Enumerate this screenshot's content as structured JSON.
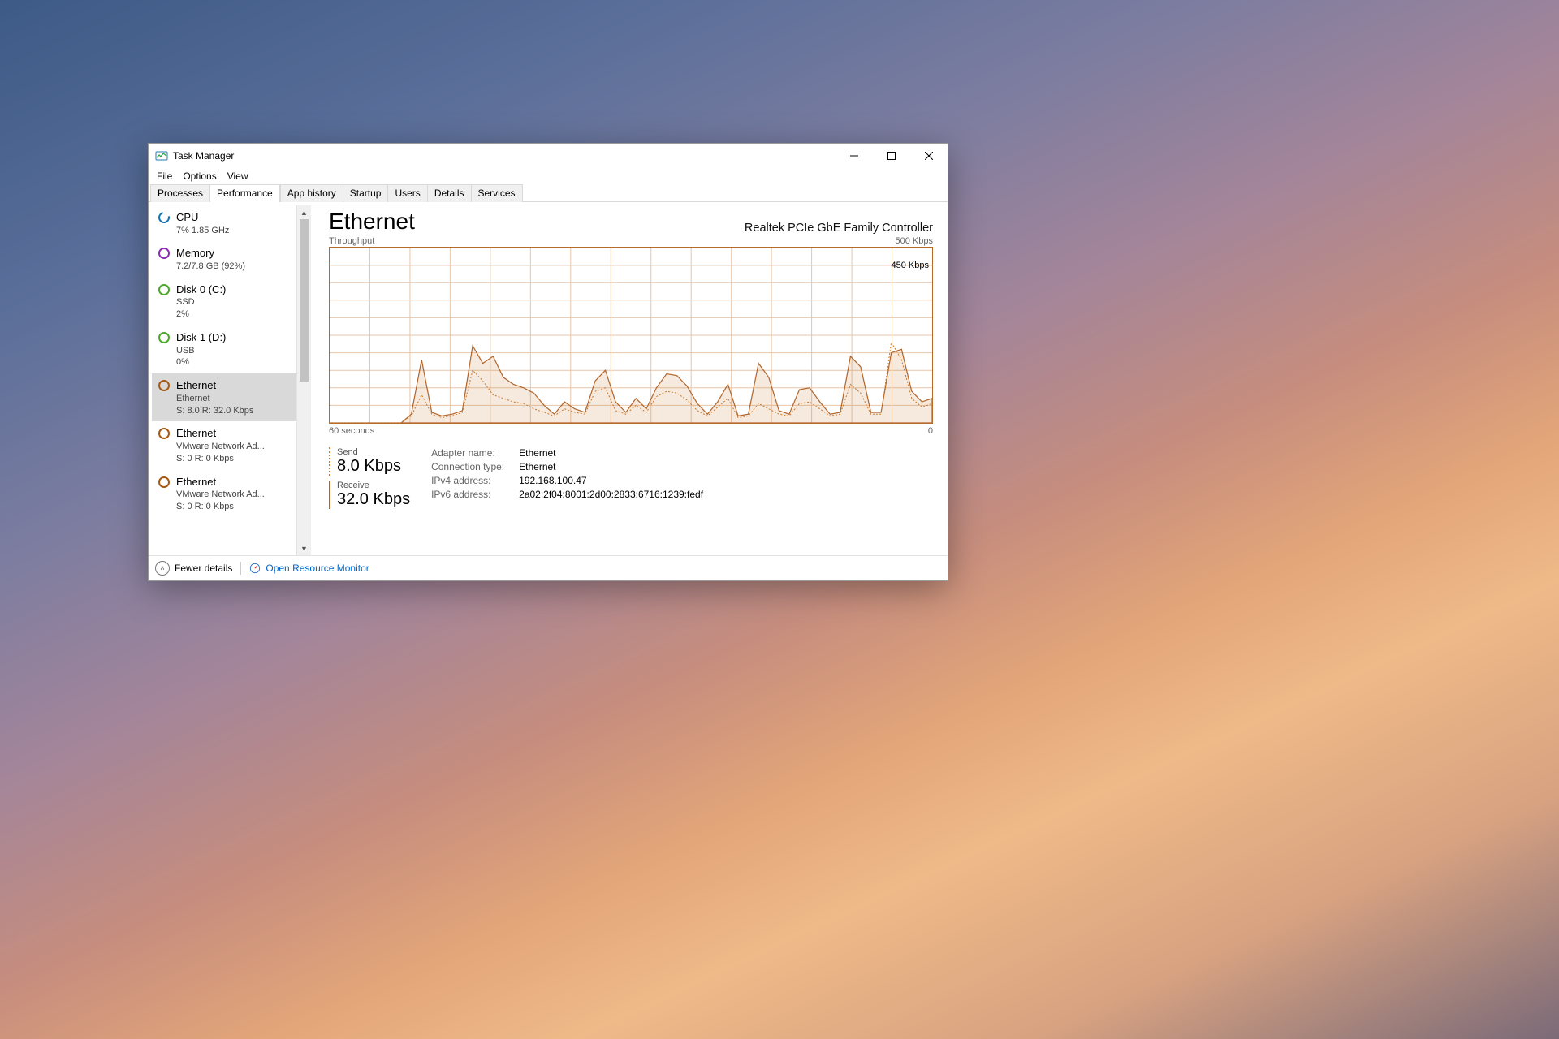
{
  "window": {
    "title": "Task Manager"
  },
  "menu": {
    "file": "File",
    "options": "Options",
    "view": "View"
  },
  "tabs": {
    "processes": "Processes",
    "performance": "Performance",
    "app_history": "App history",
    "startup": "Startup",
    "users": "Users",
    "details": "Details",
    "services": "Services"
  },
  "sidebar": {
    "items": [
      {
        "title": "CPU",
        "sub": "7% 1.85 GHz"
      },
      {
        "title": "Memory",
        "sub": "7.2/7.8 GB (92%)"
      },
      {
        "title": "Disk 0 (C:)",
        "sub1": "SSD",
        "sub2": "2%"
      },
      {
        "title": "Disk 1 (D:)",
        "sub1": "USB",
        "sub2": "0%"
      },
      {
        "title": "Ethernet",
        "sub1": "Ethernet",
        "sub2": "S: 8.0 R: 32.0 Kbps"
      },
      {
        "title": "Ethernet",
        "sub1": "VMware Network Ad...",
        "sub2": "S: 0 R: 0 Kbps"
      },
      {
        "title": "Ethernet",
        "sub1": "VMware Network Ad...",
        "sub2": "S: 0 R: 0 Kbps"
      }
    ]
  },
  "main": {
    "title": "Ethernet",
    "adapter": "Realtek PCIe GbE Family Controller",
    "chart_label_left": "Throughput",
    "chart_label_right": "500 Kbps",
    "chart_marker": "450 Kbps",
    "x_left": "60 seconds",
    "x_right": "0",
    "send_label": "Send",
    "send_value": "8.0 Kbps",
    "recv_label": "Receive",
    "recv_value": "32.0 Kbps",
    "props": {
      "adapter_name_k": "Adapter name:",
      "adapter_name_v": "Ethernet",
      "conn_type_k": "Connection type:",
      "conn_type_v": "Ethernet",
      "ipv4_k": "IPv4 address:",
      "ipv4_v": "192.168.100.47",
      "ipv6_k": "IPv6 address:",
      "ipv6_v": "2a02:2f04:8001:2d00:2833:6716:1239:fedf"
    }
  },
  "footer": {
    "fewer": "Fewer details",
    "rm": "Open Resource Monitor"
  },
  "chart_data": {
    "type": "line",
    "title": "Throughput",
    "ylabel": "Kbps",
    "ylim": [
      0,
      500
    ],
    "x_range_label": "60 seconds",
    "marker_value": 450,
    "series": [
      {
        "name": "Receive",
        "values": [
          0,
          0,
          0,
          0,
          0,
          0,
          0,
          0,
          25,
          180,
          30,
          20,
          25,
          35,
          220,
          170,
          190,
          130,
          110,
          100,
          85,
          50,
          25,
          60,
          40,
          30,
          120,
          150,
          60,
          30,
          70,
          40,
          100,
          140,
          135,
          105,
          55,
          25,
          60,
          110,
          20,
          25,
          170,
          130,
          35,
          25,
          95,
          100,
          60,
          25,
          30,
          190,
          160,
          30,
          30,
          200,
          210,
          90,
          60,
          70
        ]
      },
      {
        "name": "Send",
        "values": [
          0,
          0,
          0,
          0,
          0,
          0,
          0,
          0,
          20,
          80,
          25,
          15,
          20,
          30,
          150,
          120,
          80,
          70,
          60,
          55,
          40,
          30,
          20,
          40,
          30,
          25,
          90,
          100,
          35,
          25,
          50,
          30,
          75,
          90,
          85,
          65,
          35,
          20,
          45,
          70,
          15,
          20,
          55,
          40,
          25,
          20,
          55,
          60,
          40,
          20,
          25,
          110,
          85,
          25,
          25,
          230,
          180,
          70,
          45,
          55
        ]
      }
    ]
  }
}
